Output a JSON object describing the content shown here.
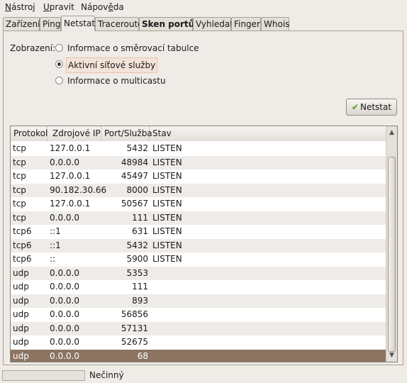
{
  "menu": [
    {
      "mnemonic": "N",
      "rest": "ástroj"
    },
    {
      "mnemonic": "U",
      "rest": "pravit"
    },
    {
      "pre": "Nápov",
      "mnemonic": "ě",
      "rest": "da"
    }
  ],
  "tabs": [
    "Zařízení",
    "Ping",
    "Netstat",
    "Traceroute",
    "Sken portů",
    "Vyhledat",
    "Finger",
    "Whois"
  ],
  "active_tab": "Netstat",
  "display": {
    "label": "Zobrazení:",
    "options": [
      {
        "label": "Informace o směrovací tabulce",
        "checked": false
      },
      {
        "label": "Aktivní síťové služby",
        "checked": true
      },
      {
        "label": "Informace o multicastu",
        "checked": false
      }
    ]
  },
  "netstat_button": "Netstat",
  "table": {
    "columns": [
      "Protokol",
      "Zdrojové IP",
      "Port/Služba",
      "Stav"
    ],
    "rows": [
      [
        "tcp",
        "127.0.0.1",
        "5432",
        "LISTEN"
      ],
      [
        "tcp",
        "0.0.0.0",
        "48984",
        "LISTEN"
      ],
      [
        "tcp",
        "127.0.0.1",
        "45497",
        "LISTEN"
      ],
      [
        "tcp",
        "90.182.30.66",
        "8000",
        "LISTEN"
      ],
      [
        "tcp",
        "127.0.0.1",
        "50567",
        "LISTEN"
      ],
      [
        "tcp",
        "0.0.0.0",
        "111",
        "LISTEN"
      ],
      [
        "tcp6",
        "::1",
        "631",
        "LISTEN"
      ],
      [
        "tcp6",
        "::1",
        "5432",
        "LISTEN"
      ],
      [
        "tcp6",
        "::",
        "5900",
        "LISTEN"
      ],
      [
        "udp",
        "0.0.0.0",
        "5353",
        ""
      ],
      [
        "udp",
        "0.0.0.0",
        "111",
        ""
      ],
      [
        "udp",
        "0.0.0.0",
        "893",
        ""
      ],
      [
        "udp",
        "0.0.0.0",
        "56856",
        ""
      ],
      [
        "udp",
        "0.0.0.0",
        "57131",
        ""
      ],
      [
        "udp",
        "0.0.0.0",
        "52675",
        ""
      ],
      [
        "udp",
        "0.0.0.0",
        "68",
        ""
      ]
    ],
    "selected_row": 15
  },
  "status": "Nečinný"
}
